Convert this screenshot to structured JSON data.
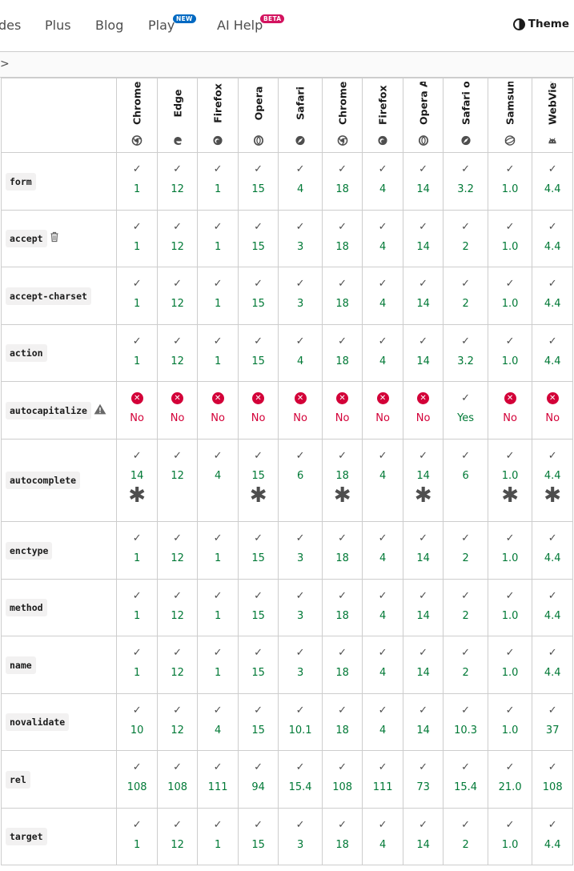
{
  "nav": {
    "items": [
      {
        "label": "des"
      },
      {
        "label": "Plus"
      },
      {
        "label": "Blog"
      },
      {
        "label": "Play",
        "badge": "NEW"
      },
      {
        "label": "AI Help",
        "badge": "BETA"
      }
    ],
    "theme_label": "Theme"
  },
  "breadcrumb": {
    "chevron": ">"
  },
  "browsers": [
    {
      "name": "Chrome",
      "icon": "chrome-icon"
    },
    {
      "name": "Edge",
      "icon": "edge-icon"
    },
    {
      "name": "Firefox",
      "icon": "firefox-icon"
    },
    {
      "name": "Opera",
      "icon": "opera-icon"
    },
    {
      "name": "Safari",
      "icon": "safari-icon"
    },
    {
      "name": "Chrome Android",
      "icon": "chrome-icon"
    },
    {
      "name": "Firefox for Android",
      "icon": "firefox-icon"
    },
    {
      "name": "Opera Android",
      "icon": "opera-icon"
    },
    {
      "name": "Safari on iOS",
      "icon": "safari-icon"
    },
    {
      "name": "Samsung Internet",
      "icon": "samsung-icon"
    },
    {
      "name": "WebView Android",
      "icon": "android-icon"
    }
  ],
  "features": [
    {
      "name": "form",
      "versions": [
        "1",
        "12",
        "1",
        "15",
        "4",
        "18",
        "4",
        "14",
        "3.2",
        "1.0",
        "4.4"
      ]
    },
    {
      "name": "accept",
      "flag": "deprecated-icon",
      "versions": [
        "1",
        "12",
        "1",
        "15",
        "3",
        "18",
        "4",
        "14",
        "2",
        "1.0",
        "4.4"
      ]
    },
    {
      "name": "accept-charset",
      "versions": [
        "1",
        "12",
        "1",
        "15",
        "3",
        "18",
        "4",
        "14",
        "2",
        "1.0",
        "4.4"
      ]
    },
    {
      "name": "action",
      "versions": [
        "1",
        "12",
        "1",
        "15",
        "4",
        "18",
        "4",
        "14",
        "3.2",
        "1.0",
        "4.4"
      ]
    },
    {
      "name": "autocapitalize",
      "flag": "warning-icon",
      "versions": [
        "No",
        "No",
        "No",
        "No",
        "No",
        "No",
        "No",
        "No",
        "Yes",
        "No",
        "No"
      ]
    },
    {
      "name": "autocomplete",
      "versions": [
        "14",
        "12",
        "4",
        "15",
        "6",
        "18",
        "4",
        "14",
        "6",
        "1.0",
        "4.4"
      ],
      "notes": [
        true,
        false,
        false,
        true,
        false,
        true,
        false,
        true,
        false,
        true,
        true
      ]
    },
    {
      "name": "enctype",
      "versions": [
        "1",
        "12",
        "1",
        "15",
        "3",
        "18",
        "4",
        "14",
        "2",
        "1.0",
        "4.4"
      ]
    },
    {
      "name": "method",
      "versions": [
        "1",
        "12",
        "1",
        "15",
        "3",
        "18",
        "4",
        "14",
        "2",
        "1.0",
        "4.4"
      ]
    },
    {
      "name": "name",
      "versions": [
        "1",
        "12",
        "1",
        "15",
        "3",
        "18",
        "4",
        "14",
        "2",
        "1.0",
        "4.4"
      ]
    },
    {
      "name": "novalidate",
      "versions": [
        "10",
        "12",
        "4",
        "15",
        "10.1",
        "18",
        "4",
        "14",
        "10.3",
        "1.0",
        "37"
      ]
    },
    {
      "name": "rel",
      "versions": [
        "108",
        "108",
        "111",
        "94",
        "15.4",
        "108",
        "111",
        "73",
        "15.4",
        "21.0",
        "108"
      ]
    },
    {
      "name": "target",
      "versions": [
        "1",
        "12",
        "1",
        "15",
        "3",
        "18",
        "4",
        "14",
        "2",
        "1.0",
        "4.4"
      ]
    }
  ],
  "symbols": {
    "check": "✓",
    "cross": "✕",
    "asterisk": "✱"
  }
}
